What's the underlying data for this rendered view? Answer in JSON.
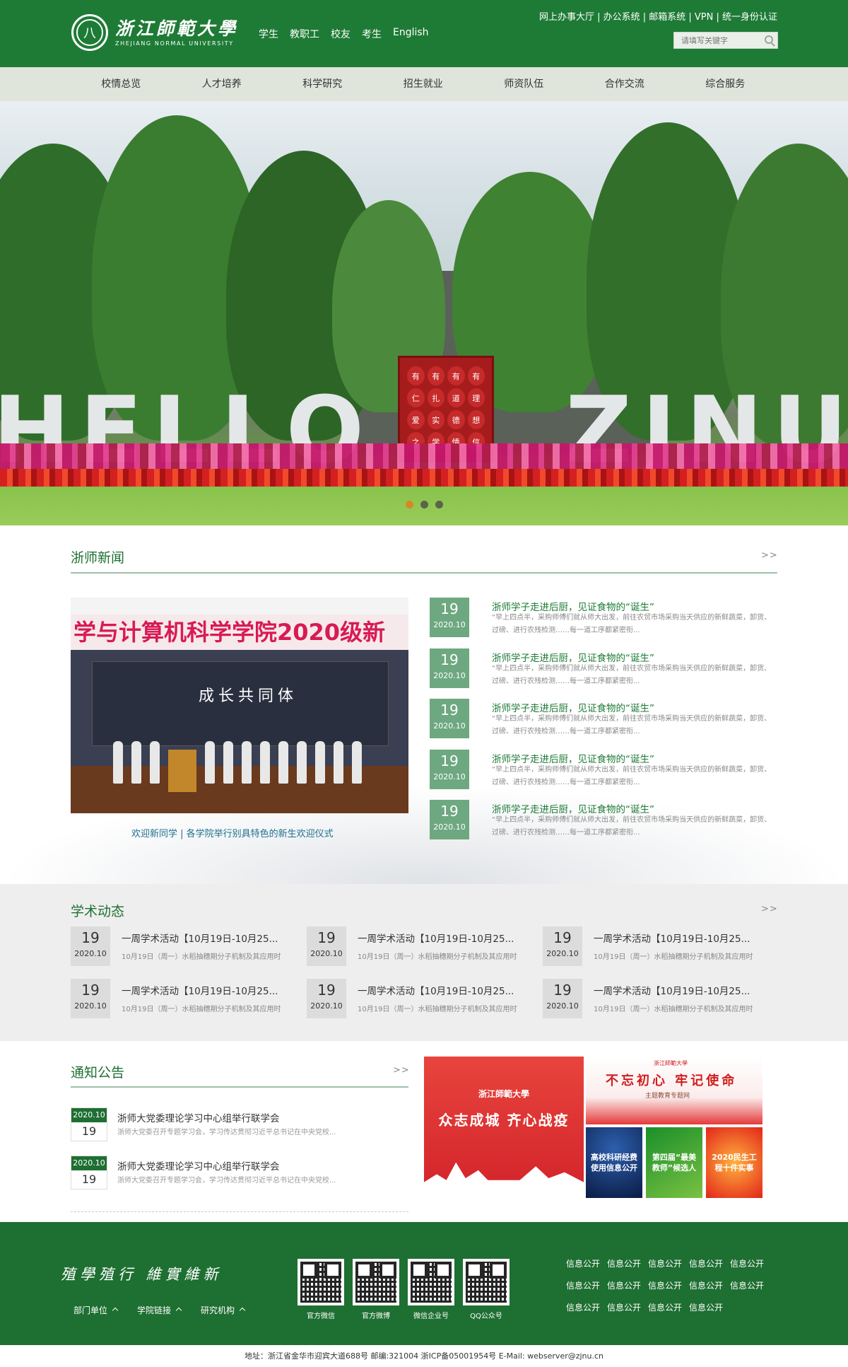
{
  "brand": {
    "logo_cn": "浙江師範大學",
    "logo_en": "ZHEJIANG NORMAL UNIVERSITY",
    "seal_char": "八"
  },
  "topnav": [
    "学生",
    "教职工",
    "校友",
    "考生",
    "English"
  ],
  "quicklinks": "网上办事大厅 | 办公系统 | 邮箱系统 | VPN | 统一身份认证",
  "search": {
    "placeholder": "请填写关键字"
  },
  "mainnav": [
    "校情总览",
    "人才培养",
    "科学研究",
    "招生就业",
    "师资队伍",
    "合作交流",
    "综合服务"
  ],
  "banner": {
    "letters_left": "HELLO",
    "letters_right": "ZJNU",
    "gate_chars": [
      "有",
      "有",
      "有",
      "有",
      "仁",
      "扎",
      "道",
      "理",
      "爱",
      "实",
      "德",
      "想",
      "之",
      "学",
      "情",
      "信"
    ],
    "slide_count": 3,
    "active_slide": 1
  },
  "news": {
    "title": "浙师新闻",
    "more": ">>",
    "photo_banner": "学与计算机科学学院2020级新",
    "photo_stage": "成长共同体",
    "caption": "欢迎新同学 | 各学院举行别具特色的新生欢迎仪式",
    "items": [
      {
        "day": "19",
        "ym": "2020.10",
        "title": "浙师学子走进后厨，见证食物的“诞生”",
        "summary": "“早上四点半，采购师傅们就从师大出发，前往农贸市场采购当天供应的新鲜蔬菜，卸货、过磅、进行农残检测……每一道工序都紧密衔..."
      },
      {
        "day": "19",
        "ym": "2020.10",
        "title": "浙师学子走进后厨，见证食物的“诞生”",
        "summary": "“早上四点半，采购师傅们就从师大出发，前往农贸市场采购当天供应的新鲜蔬菜，卸货、过磅、进行农残检测……每一道工序都紧密衔..."
      },
      {
        "day": "19",
        "ym": "2020.10",
        "title": "浙师学子走进后厨，见证食物的“诞生”",
        "summary": "“早上四点半，采购师傅们就从师大出发，前往农贸市场采购当天供应的新鲜蔬菜，卸货、过磅、进行农残检测……每一道工序都紧密衔..."
      },
      {
        "day": "19",
        "ym": "2020.10",
        "title": "浙师学子走进后厨，见证食物的“诞生”",
        "summary": "“早上四点半，采购师傅们就从师大出发，前往农贸市场采购当天供应的新鲜蔬菜，卸货、过磅、进行农残检测……每一道工序都紧密衔..."
      },
      {
        "day": "19",
        "ym": "2020.10",
        "title": "浙师学子走进后厨，见证食物的“诞生”",
        "summary": "“早上四点半，采购师傅们就从师大出发，前往农贸市场采购当天供应的新鲜蔬菜，卸货、过磅、进行农残检测……每一道工序都紧密衔..."
      }
    ]
  },
  "academic": {
    "title": "学术动态",
    "more": ">>",
    "items": [
      {
        "day": "19",
        "ym": "2020.10",
        "title": "一周学术活动【10月19日-10月25...",
        "summary": "10月19日（周一）水稻抽穗期分子机制及其应用时"
      },
      {
        "day": "19",
        "ym": "2020.10",
        "title": "一周学术活动【10月19日-10月25...",
        "summary": "10月19日（周一）水稻抽穗期分子机制及其应用时"
      },
      {
        "day": "19",
        "ym": "2020.10",
        "title": "一周学术活动【10月19日-10月25...",
        "summary": "10月19日（周一）水稻抽穗期分子机制及其应用时"
      },
      {
        "day": "19",
        "ym": "2020.10",
        "title": "一周学术活动【10月19日-10月25...",
        "summary": "10月19日（周一）水稻抽穗期分子机制及其应用时"
      },
      {
        "day": "19",
        "ym": "2020.10",
        "title": "一周学术活动【10月19日-10月25...",
        "summary": "10月19日（周一）水稻抽穗期分子机制及其应用时"
      },
      {
        "day": "19",
        "ym": "2020.10",
        "title": "一周学术活动【10月19日-10月25...",
        "summary": "10月19日（周一）水稻抽穗期分子机制及其应用时"
      }
    ]
  },
  "notice": {
    "title": "通知公告",
    "more": ">>",
    "items": [
      {
        "ym": "2020.10",
        "day": "19",
        "title": "浙师大党委理论学习中心组举行联学会",
        "summary": "浙师大党委召开专题学习会，学习传达贯彻习近平总书记在中央党校..."
      },
      {
        "ym": "2020.10",
        "day": "19",
        "title": "浙师大党委理论学习中心组举行联学会",
        "summary": "浙师大党委召开专题学习会，学习传达贯彻习近平总书记在中央党校..."
      }
    ]
  },
  "promos": {
    "big_brand": "浙江師範大學",
    "big_slogan": "众志成城 齐心战疫",
    "wide_mark": "浙江師範大學",
    "wide_title": "不忘初心 牢记使命",
    "wide_sub": "主题教育专题网",
    "tile1": "高校科研经费使用信息公开",
    "tile2": "第四届“最美教师”候选人",
    "tile3": "2020民生工程十件实事"
  },
  "footer": {
    "motto": "殖學殖行 維實維新",
    "links": [
      "部门单位",
      "学院链接",
      "研究机构"
    ],
    "qrcodes": [
      "官方微信",
      "官方微博",
      "微信企业号",
      "QQ公众号"
    ],
    "info_links": [
      "信息公开",
      "信息公开",
      "信息公开",
      "信息公开",
      "信息公开",
      "信息公开",
      "信息公开",
      "信息公开",
      "信息公开",
      "信息公开",
      "信息公开",
      "信息公开",
      "信息公开",
      "信息公开"
    ],
    "address": "地址：浙江省金华市迎宾大道688号 邮编:321004 浙ICP备05001954号 E-Mail: webserver@zjnu.cn"
  },
  "colors": {
    "primary": "#1e7b36",
    "nav_bg": "#dfe5da",
    "date_green": "#6ea880",
    "accent_dot": "#e8771e"
  }
}
